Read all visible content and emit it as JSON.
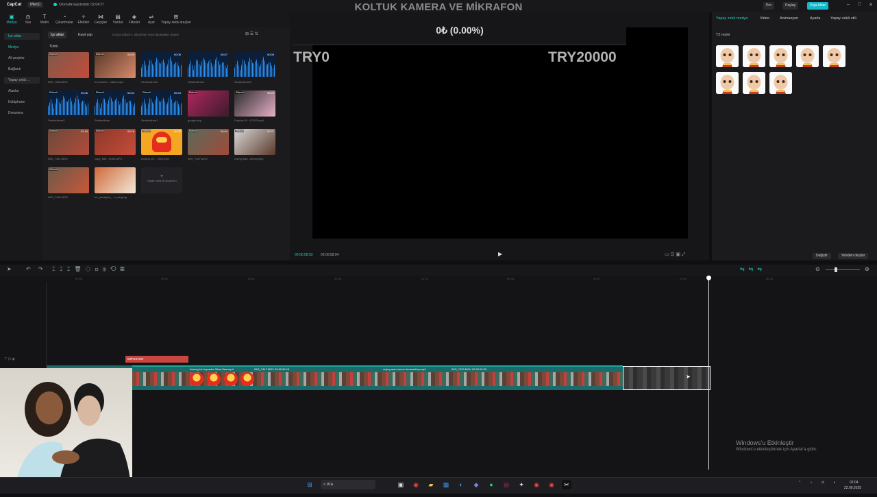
{
  "overlay": {
    "title": "KOLTUK KAMERA VE MİKRAFON",
    "progress_text": "0₺ (0.00%)",
    "start_amount": "TRY0",
    "goal_amount": "TRY20000"
  },
  "titlebar": {
    "app": "CapCut",
    "menu": "Menü",
    "autosave": "Otomatik kaydedildi: 02:04:27",
    "pro": "Pro",
    "share": "Paylaş",
    "export": "Dışa Aktar"
  },
  "toolbar": {
    "items": [
      {
        "label": "Medya",
        "icon": "media-icon"
      },
      {
        "label": "Ses",
        "icon": "audio-icon"
      },
      {
        "label": "Metin",
        "icon": "text-icon"
      },
      {
        "label": "Çıkartmalar",
        "icon": "stickers-icon"
      },
      {
        "label": "Efektler",
        "icon": "effects-icon"
      },
      {
        "label": "Geçişler",
        "icon": "transitions-icon"
      },
      {
        "label": "Yazılar",
        "icon": "captions-icon"
      },
      {
        "label": "Filtreler",
        "icon": "filters-icon"
      },
      {
        "label": "Ayar",
        "icon": "adjust-icon"
      },
      {
        "label": "Yapay zekâ araçları",
        "icon": "ai-tools-icon"
      }
    ]
  },
  "leftnav": {
    "items": [
      "İçe aktar",
      "Medya",
      "Alt projeler",
      "Bağlantı",
      "Yapay zekâ ...",
      "Alanlar",
      "Kütüphane",
      "Dreamina"
    ]
  },
  "media": {
    "import_tab": "İçe aktar",
    "record_tab": "Kayıt yap",
    "search_placeholder": "Dosya adlarını, altyazıları veya diyalogları arayın",
    "all_label": "Tümü",
    "added_badge": "Eklendi",
    "items": [
      {
        "name": "IMG_7538.MOV",
        "dur": "",
        "kind": "video",
        "c1": "#7c5a4a",
        "c2": "#c44b3b"
      },
      {
        "name": "trin.smell.n...nation.mp4",
        "dur": "00:04",
        "kind": "video",
        "c1": "#5a3a2a",
        "c2": "#d98a6a"
      },
      {
        "name": "Seslendirme5",
        "dur": "00:05",
        "kind": "audio"
      },
      {
        "name": "Seslendirme4",
        "dur": "00:07",
        "kind": "audio"
      },
      {
        "name": "Seslendirme3",
        "dur": "00:05",
        "kind": "audio"
      },
      {
        "name": "Seslendirme2",
        "dur": "00:06",
        "kind": "audio"
      },
      {
        "name": "Seslendirme",
        "dur": "00:04",
        "kind": "audio"
      },
      {
        "name": "Seslendirme1",
        "dur": "00:04",
        "kind": "audio"
      },
      {
        "name": "google.png",
        "dur": "",
        "kind": "image",
        "c1": "#b0275e",
        "c2": "#3b1b2e"
      },
      {
        "name": "Popular W...4 2023.mp4",
        "dur": "05:26",
        "kind": "video",
        "c1": "#2a2a2a",
        "c2": "#e8b0c8"
      },
      {
        "name": "IMG_7441.MOV",
        "dur": "02:18",
        "kind": "video",
        "c1": "#6a4a3a",
        "c2": "#b34a3a"
      },
      {
        "name": "copy_682...FD06.MP4",
        "dur": "00:16",
        "kind": "video",
        "c1": "#8a3a2a",
        "c2": "#c84b3a"
      },
      {
        "name": "Among Us ... Sesi.mp4",
        "dur": "00:05",
        "kind": "among"
      },
      {
        "name": "IMG_7447.MOV",
        "dur": "00:04",
        "kind": "video",
        "c1": "#5a6a5a",
        "c2": "#a04a3a"
      },
      {
        "name": "crying man...emory.mp4",
        "dur": "00:07",
        "kind": "video",
        "c1": "#d8d8d8",
        "c2": "#5a3a2a"
      },
      {
        "name": "IMG_7440.MOV",
        "dur": "",
        "kind": "video",
        "c1": "#6a5a4a",
        "c2": "#c9573a"
      },
      {
        "name": "bir_pasagine_...o_var.jpeg",
        "dur": "",
        "kind": "image",
        "c1": "#d06a3a",
        "c2": "#f2e8d8"
      }
    ],
    "drop_hint": "Yapay zekâ ile oluşturun"
  },
  "preview": {
    "time_current": "00:00:58:03",
    "time_total": "00:00:58:04"
  },
  "rightpanel": {
    "tabs": [
      "Yapay zekâ medya",
      "Video",
      "Animasyon",
      "Ayarla",
      "Yapay zekâ stili"
    ],
    "subtitle": "YZ resmi",
    "change_btn": "Değiştir",
    "regen_btn": "Yeniden oluştur"
  },
  "timeline": {
    "ticks": [
      "00:00",
      "00:02",
      "00:41",
      "00:48",
      "01:01",
      "00:04",
      "00:07",
      "01:00",
      "00:03"
    ],
    "impostor_label": "IMPOSTER",
    "clip_labels": [
      "IMG_7441.MOV 00:00:00:00",
      "Among Us İmposter Olma Sesi.mp4",
      "IMG_7447.MOV 00:00:34:15",
      "crying man meme #meme#cry.mp4",
      "IMG_7430.MOV 00:00:00:29"
    ]
  },
  "windows": {
    "activate_title": "Windows'u Etkinleştir",
    "activate_hint": "Windows'u etkinleştirmek için Ayarlar'a gidin."
  },
  "taskbar": {
    "search": "Ara",
    "time": "02:04",
    "date": "22.09.2025"
  }
}
